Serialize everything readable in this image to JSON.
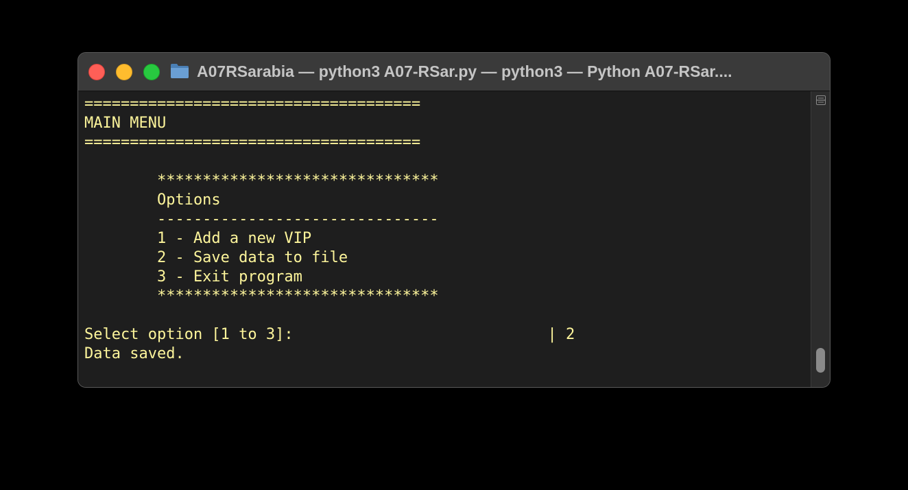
{
  "window": {
    "title": "A07RSarabia — python3 A07-RSar.py — python3 — Python A07-RSar...."
  },
  "terminal": {
    "lines": [
      "=====================================",
      "MAIN MENU",
      "=====================================",
      "",
      "        *******************************",
      "        Options",
      "        -------------------------------",
      "        1 - Add a new VIP",
      "        2 - Save data to file",
      "        3 - Exit program",
      "        *******************************",
      "",
      "Select option [1 to 3]:                            | 2",
      "Data saved."
    ]
  },
  "colors": {
    "terminal_text": "#fdf59b",
    "terminal_bg": "#1e1e1e",
    "titlebar_bg": "#3a3a3a"
  },
  "icons": {
    "folder": "folder-icon",
    "split": "split-pane-icon"
  }
}
